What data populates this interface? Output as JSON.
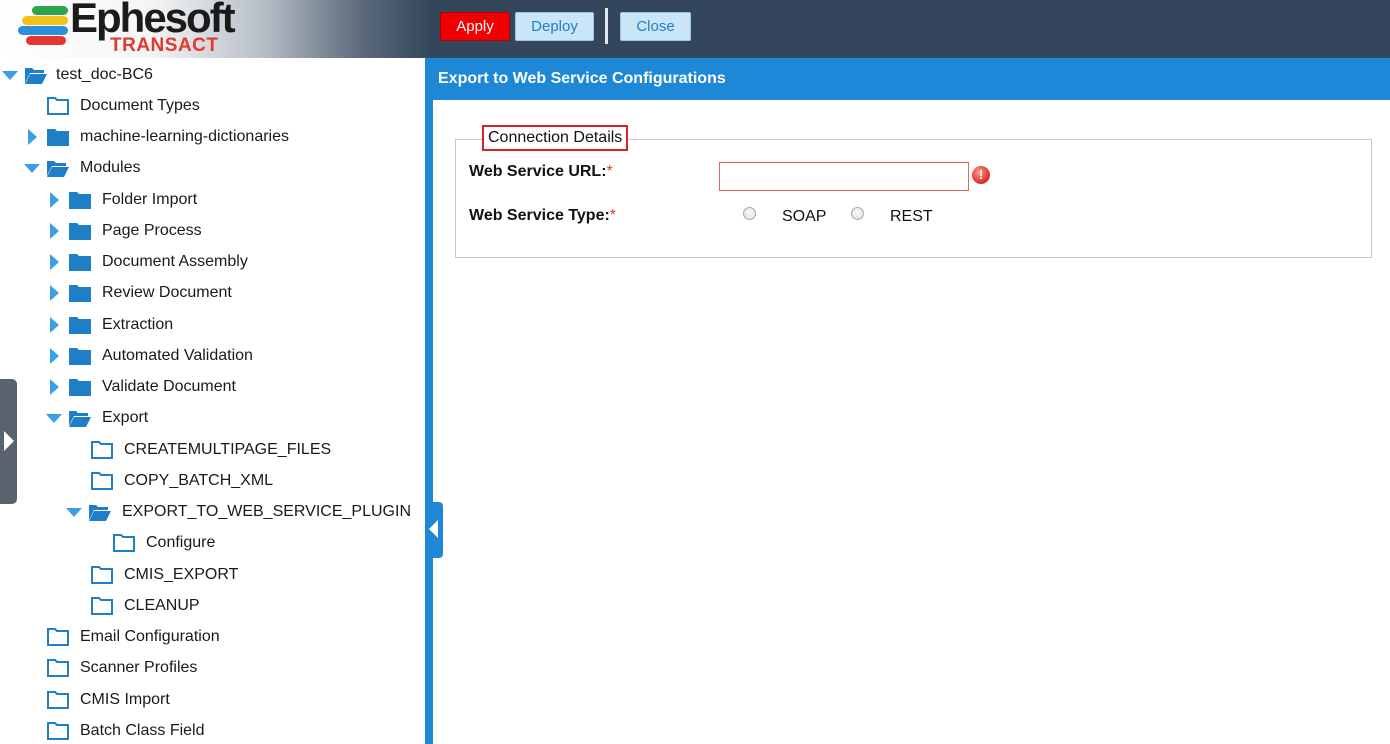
{
  "header": {
    "logo_name": "Ephesoft",
    "logo_sub": "TRANSACT",
    "apply_label": "Apply",
    "deploy_label": "Deploy",
    "close_label": "Close"
  },
  "tree": {
    "items": [
      {
        "label": "test_doc-BC6"
      },
      {
        "label": "Document Types"
      },
      {
        "label": "machine-learning-dictionaries"
      },
      {
        "label": "Modules"
      },
      {
        "label": "Folder Import"
      },
      {
        "label": "Page Process"
      },
      {
        "label": "Document Assembly"
      },
      {
        "label": "Review Document"
      },
      {
        "label": "Extraction"
      },
      {
        "label": "Automated Validation"
      },
      {
        "label": "Validate Document"
      },
      {
        "label": "Export"
      },
      {
        "label": "CREATEMULTIPAGE_FILES"
      },
      {
        "label": "COPY_BATCH_XML"
      },
      {
        "label": "EXPORT_TO_WEB_SERVICE_PLUGIN"
      },
      {
        "label": "Configure"
      },
      {
        "label": "CMIS_EXPORT"
      },
      {
        "label": "CLEANUP"
      },
      {
        "label": "Email Configuration"
      },
      {
        "label": "Scanner Profiles"
      },
      {
        "label": "CMIS Import"
      },
      {
        "label": "Batch Class Field"
      }
    ]
  },
  "main": {
    "title": "Export to Web Service Configurations",
    "fieldset_legend": "Connection Details",
    "url_label": "Web Service URL:",
    "url_value": "",
    "type_label": "Web Service Type:",
    "required_mark": "*",
    "error_glyph": "!",
    "options": [
      "SOAP",
      "REST"
    ]
  },
  "colors": {
    "accent": "#1e88d6",
    "apply": "#f00000",
    "header": "#34465b",
    "folder": "#1f7fc6",
    "error": "#e2382f"
  }
}
